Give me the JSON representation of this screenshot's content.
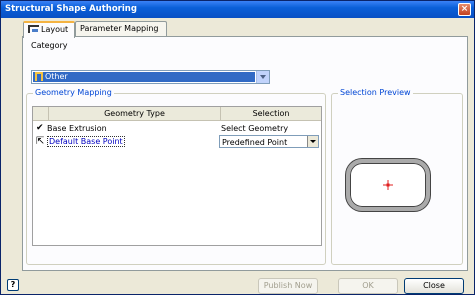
{
  "window": {
    "title": "Structural Shape Authoring"
  },
  "tabs": [
    {
      "label": "Layout",
      "active": true,
      "icon": "layout-icon"
    },
    {
      "label": "Parameter Mapping",
      "active": false
    }
  ],
  "category": {
    "label": "Category",
    "selected": "Other",
    "icon": "shape-category-icon"
  },
  "geometry_mapping": {
    "title": "Geometry Mapping",
    "columns": [
      "Geometry Type",
      "Selection"
    ],
    "rows": [
      {
        "type": "Base Extrusion",
        "selection": "Select Geometry",
        "checked": true,
        "selected": false
      },
      {
        "type": "Default Base Point",
        "selection": "Predefined Point",
        "checked": false,
        "selected": true
      }
    ]
  },
  "selection_preview": {
    "title": "Selection Preview"
  },
  "buttons": {
    "help": "?",
    "publish": "Publish Now",
    "ok": "OK",
    "close": "Close"
  },
  "colors": {
    "titlebar": "#0a5fd8",
    "selection": "#316ac5",
    "preview_point": "#e02020"
  }
}
